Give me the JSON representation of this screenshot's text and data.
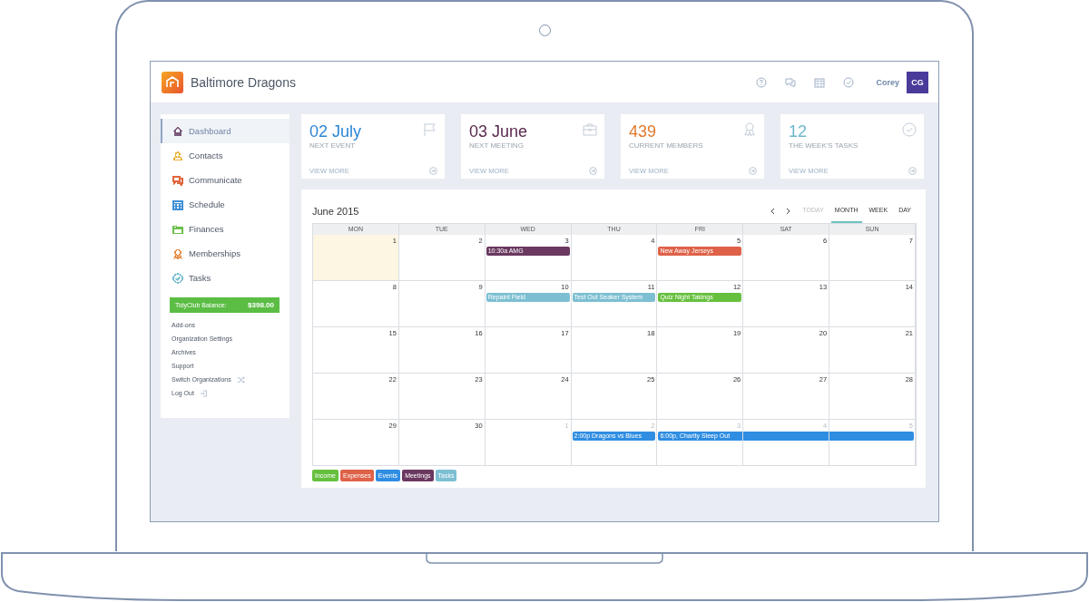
{
  "header": {
    "org_name": "Baltimore Dragons",
    "icons": [
      {
        "kind": "help"
      },
      {
        "kind": "chat"
      },
      {
        "kind": "calendar"
      },
      {
        "kind": "check"
      }
    ],
    "user_name": "Corey",
    "avatar": "CG"
  },
  "sidebar": {
    "items": [
      {
        "label": "Dashboard",
        "kind": "home",
        "selected": true,
        "color": "#7a5a7a"
      },
      {
        "label": "Contacts",
        "kind": "contacts",
        "selected": false,
        "color": "#e8b33a"
      },
      {
        "label": "Communicate",
        "kind": "chat",
        "selected": false,
        "color": "#e0673f"
      },
      {
        "label": "Schedule",
        "kind": "calendar",
        "selected": false,
        "color": "#3e8fd6"
      },
      {
        "label": "Finances",
        "kind": "folder",
        "selected": false,
        "color": "#6cc04a"
      },
      {
        "label": "Memberships",
        "kind": "award",
        "selected": false,
        "color": "#e8904a"
      },
      {
        "label": "Tasks",
        "kind": "check",
        "selected": false,
        "color": "#7bbfd0"
      }
    ],
    "balance": {
      "label": "TidyClub Balance:",
      "amount": "$398.00"
    },
    "links": [
      {
        "label": "Add-ons"
      },
      {
        "label": "Organization Settings"
      },
      {
        "label": "Archives"
      },
      {
        "label": "Support"
      },
      {
        "label": "Switch Organizations"
      },
      {
        "label": "Log Out"
      }
    ]
  },
  "stats": [
    {
      "value": "02 July",
      "label": "NEXT EVENT",
      "link": "VIEW MORE",
      "color": "#2e86d4"
    },
    {
      "value": "03 June",
      "label": "NEXT MEETING",
      "link": "VIEW MORE",
      "color": "#5a2a4e"
    },
    {
      "value": "439",
      "label": "CURRENT MEMBERS",
      "link": "VIEW MORE",
      "color": "#e07a2e"
    },
    {
      "value": "12",
      "label": "THE WEEK'S TASKS",
      "link": "VIEW MORE",
      "color": "#6bb7cc"
    }
  ],
  "calendar": {
    "title": "June 2015",
    "nav": [
      {
        "label": "TODAY",
        "disabled": true,
        "selected": false
      },
      {
        "label": "MONTH",
        "disabled": false,
        "selected": true
      },
      {
        "label": "WEEK",
        "disabled": false,
        "selected": false
      },
      {
        "label": "DAY",
        "disabled": false,
        "selected": false
      }
    ],
    "weekdays": [
      "MON",
      "TUE",
      "WED",
      "THU",
      "FRI",
      "SAT",
      "SUN"
    ],
    "weeks": [
      {
        "days": [
          {
            "n": "1",
            "today": true,
            "muted": false
          },
          {
            "n": "2",
            "today": false,
            "muted": false
          },
          {
            "n": "3",
            "today": false,
            "muted": false,
            "events": [
              {
                "text": "10:30a AMG",
                "kind": "meetings"
              }
            ]
          },
          {
            "n": "4",
            "today": false,
            "muted": false
          },
          {
            "n": "5",
            "today": false,
            "muted": false,
            "events": [
              {
                "text": "New Away Jerseys",
                "kind": "expenses"
              }
            ]
          },
          {
            "n": "6",
            "today": false,
            "muted": false
          },
          {
            "n": "7",
            "today": false,
            "muted": false
          }
        ]
      },
      {
        "days": [
          {
            "n": "8",
            "today": false,
            "muted": false
          },
          {
            "n": "9",
            "today": false,
            "muted": false
          },
          {
            "n": "10",
            "today": false,
            "muted": false,
            "events": [
              {
                "text": "Repaint Field",
                "kind": "tasks"
              }
            ]
          },
          {
            "n": "11",
            "today": false,
            "muted": false,
            "events": [
              {
                "text": "Test Out Seaker System",
                "kind": "tasks"
              }
            ]
          },
          {
            "n": "12",
            "today": false,
            "muted": false,
            "events": [
              {
                "text": "Quiz Night Takings",
                "kind": "income"
              }
            ]
          },
          {
            "n": "13",
            "today": false,
            "muted": false
          },
          {
            "n": "14",
            "today": false,
            "muted": false
          }
        ]
      },
      {
        "days": [
          {
            "n": "15",
            "today": false,
            "muted": false
          },
          {
            "n": "16",
            "today": false,
            "muted": false
          },
          {
            "n": "17",
            "today": false,
            "muted": false
          },
          {
            "n": "18",
            "today": false,
            "muted": false
          },
          {
            "n": "19",
            "today": false,
            "muted": false
          },
          {
            "n": "20",
            "today": false,
            "muted": false
          },
          {
            "n": "21",
            "today": false,
            "muted": false
          }
        ]
      },
      {
        "days": [
          {
            "n": "22",
            "today": false,
            "muted": false
          },
          {
            "n": "23",
            "today": false,
            "muted": false
          },
          {
            "n": "24",
            "today": false,
            "muted": false
          },
          {
            "n": "25",
            "today": false,
            "muted": false
          },
          {
            "n": "26",
            "today": false,
            "muted": false
          },
          {
            "n": "27",
            "today": false,
            "muted": false
          },
          {
            "n": "28",
            "today": false,
            "muted": false
          }
        ]
      },
      {
        "days": [
          {
            "n": "29",
            "today": false,
            "muted": false
          },
          {
            "n": "30",
            "today": false,
            "muted": false
          },
          {
            "n": "1",
            "today": false,
            "muted": true
          },
          {
            "n": "2",
            "today": false,
            "muted": true,
            "events": [
              {
                "text": "2:00p Dragons vs Blues",
                "kind": "events"
              }
            ]
          },
          {
            "n": "3",
            "today": false,
            "muted": true,
            "events": [
              {
                "text": "6:00p, Charity Sleep Out",
                "kind": "events"
              }
            ]
          },
          {
            "n": "4",
            "today": false,
            "muted": true,
            "events": [
              {
                "kind": "events",
                "continued": true
              }
            ]
          },
          {
            "n": "5",
            "today": false,
            "muted": true,
            "events": [
              {
                "kind": "events",
                "continued": true
              }
            ]
          }
        ]
      }
    ],
    "legend": [
      {
        "label": "Income",
        "kind": "income"
      },
      {
        "label": "Expenses",
        "kind": "expenses"
      },
      {
        "label": "Events",
        "kind": "events"
      },
      {
        "label": "Meetings",
        "kind": "meetings"
      },
      {
        "label": "Tasks",
        "kind": "tasks"
      }
    ]
  }
}
